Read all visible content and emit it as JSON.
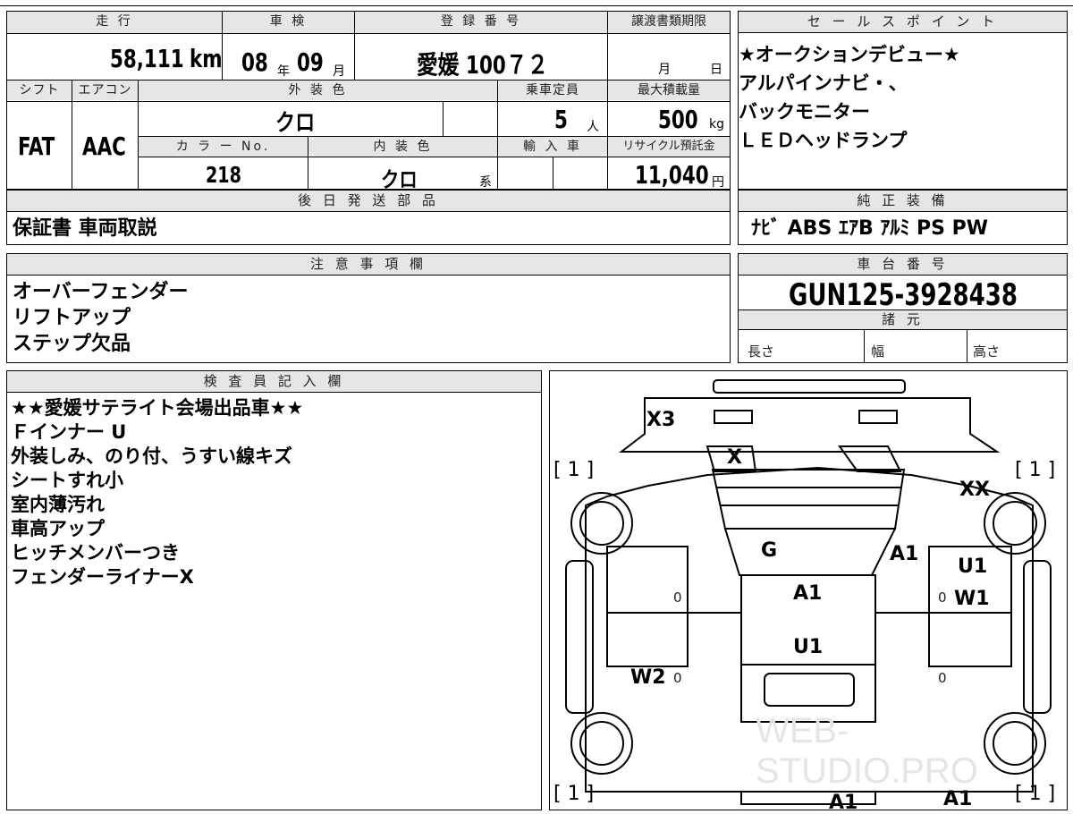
{
  "main_table": {
    "mileage": {
      "header": "走 行",
      "value": "58,111",
      "unit": "km"
    },
    "inspection": {
      "header": "車 検",
      "year": "08",
      "year_unit": "年",
      "month": "09",
      "month_unit": "月"
    },
    "registration": {
      "header": "登 録 番 号",
      "value": "愛媛 100７２"
    },
    "transfer_deadline": {
      "header": "譲渡書類期限",
      "month_unit": "月",
      "day_unit": "日"
    },
    "shift": {
      "header": "シフト",
      "value": "FAT"
    },
    "aircon": {
      "header": "エアコン",
      "value": "AAC"
    },
    "exterior_color": {
      "header": "外 装 色",
      "value": "クロ"
    },
    "capacity": {
      "header": "乗車定員",
      "value": "5",
      "unit": "人"
    },
    "max_load": {
      "header": "最大積載量",
      "value": "500",
      "unit": "kg"
    },
    "color_no": {
      "header": "カ ラ ー No.",
      "value": "218"
    },
    "interior_color": {
      "header": "内 装 色",
      "value": "クロ",
      "unit": "系"
    },
    "import": {
      "header": "輸 入 車"
    },
    "recycle_fee": {
      "header": "リサイクル預託金",
      "value": "11,040",
      "unit": "円"
    }
  },
  "later_parts": {
    "header": "後 日 発 送 部 品",
    "value": "保証書 車両取説"
  },
  "sales_points": {
    "header": "セ ー ル ス ポ イ ン ト",
    "lines": [
      "★オークションデビュー★",
      "アルパインナビ・、",
      "バックモニター",
      "ＬＥＤヘッドランプ"
    ]
  },
  "equipment": {
    "header": "純 正 装 備",
    "value": "ﾅﾋﾞ ABS ｴｱB ｱﾙﾐ PS PW"
  },
  "notes": {
    "header": "注 意 事 項 欄",
    "lines": [
      "オーバーフェンダー",
      "リフトアップ",
      "ステップ欠品"
    ]
  },
  "chassis": {
    "header": "車 台 番 号",
    "value": "GUN125-3928438"
  },
  "specs": {
    "header": "諸 元",
    "length_label": "長さ",
    "width_label": "幅",
    "height_label": "高さ"
  },
  "inspector": {
    "header": "検 査 員 記 入 欄",
    "lines": [
      "★★愛媛サテライト会場出品車★★",
      "Ｆインナー U",
      "外装しみ、のり付、うすい線キズ",
      "シートすれ小",
      "室内薄汚れ",
      "車高アップ",
      "ヒッチメンバーつき",
      "フェンダーライナーX"
    ]
  },
  "diagram": {
    "marks": {
      "x3": "X3",
      "x": "X",
      "xx": "XX",
      "g": "G",
      "a1_right": "A1",
      "u1_right": "U1",
      "w1": "W1",
      "a1_center": "A1",
      "u1_center": "U1",
      "w2": "W2",
      "a1_bottom": "A1",
      "a1_bottom2": "A1",
      "zero_left1": "0",
      "zero_right1": "0",
      "zero_left2": "0",
      "zero_right2": "0"
    },
    "tires": {
      "fl": "[ 1 ]",
      "fr": "[ 1 ]",
      "rl": "[ 1 ]",
      "rr": "[ 1 ]"
    },
    "watermark": "WEB-STUDIO.PRO"
  }
}
